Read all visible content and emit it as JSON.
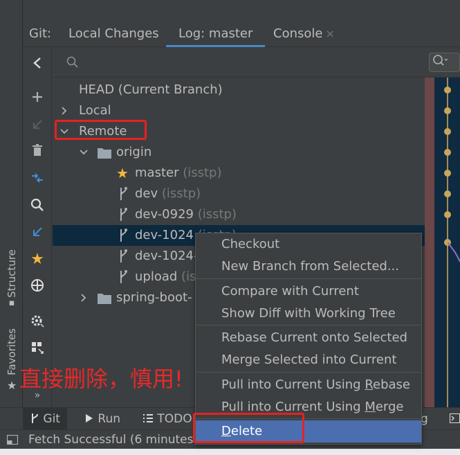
{
  "left_strip": {
    "structure_label": "Structure",
    "favorites_label": "Favorites"
  },
  "tabs": {
    "prefix": "Git:",
    "items": [
      {
        "label": "Local Changes"
      },
      {
        "label": "Log: master"
      },
      {
        "label": "Console"
      }
    ],
    "close_glyph": "×"
  },
  "tree": {
    "head": "HEAD (Current Branch)",
    "local": "Local",
    "remote": "Remote",
    "origin": "origin",
    "branches": [
      {
        "name": "master",
        "sub": "(isstp)"
      },
      {
        "name": "dev",
        "sub": "(isstp)"
      },
      {
        "name": "dev-0929",
        "sub": "(isstp)"
      },
      {
        "name": "dev-1024",
        "sub": "(isstp)"
      },
      {
        "name": "dev-1024-",
        "sub": ""
      },
      {
        "name": "upload",
        "sub": "(is"
      }
    ],
    "spring": "spring-boot-"
  },
  "context_menu": {
    "checkout": "Checkout",
    "new_branch": "New Branch from Selected...",
    "compare": "Compare with Current",
    "show_diff": "Show Diff with Working Tree",
    "rebase_onto": "Rebase Current onto Selected",
    "merge_into": "Merge Selected into Current",
    "pull_rebase_pre": "Pull into Current Using ",
    "pull_rebase_u": "R",
    "pull_rebase_post": "ebase",
    "pull_merge_pre": "Pull into Current Using ",
    "pull_merge_u": "M",
    "pull_merge_post": "erge",
    "delete_u": "D",
    "delete_post": "elete"
  },
  "bottom_tabs": {
    "git": "Git",
    "run": "Run",
    "todo": "TODO",
    "partial_right": "g"
  },
  "status": {
    "text": "Fetch Successful (6 minutes"
  },
  "annotation": {
    "text": "直接删除，慎用!"
  },
  "colors": {
    "accent": "#4b6eaf",
    "selected_row": "#0d293e",
    "annotation_red": "#e52a2a",
    "star": "#f4b63d"
  }
}
